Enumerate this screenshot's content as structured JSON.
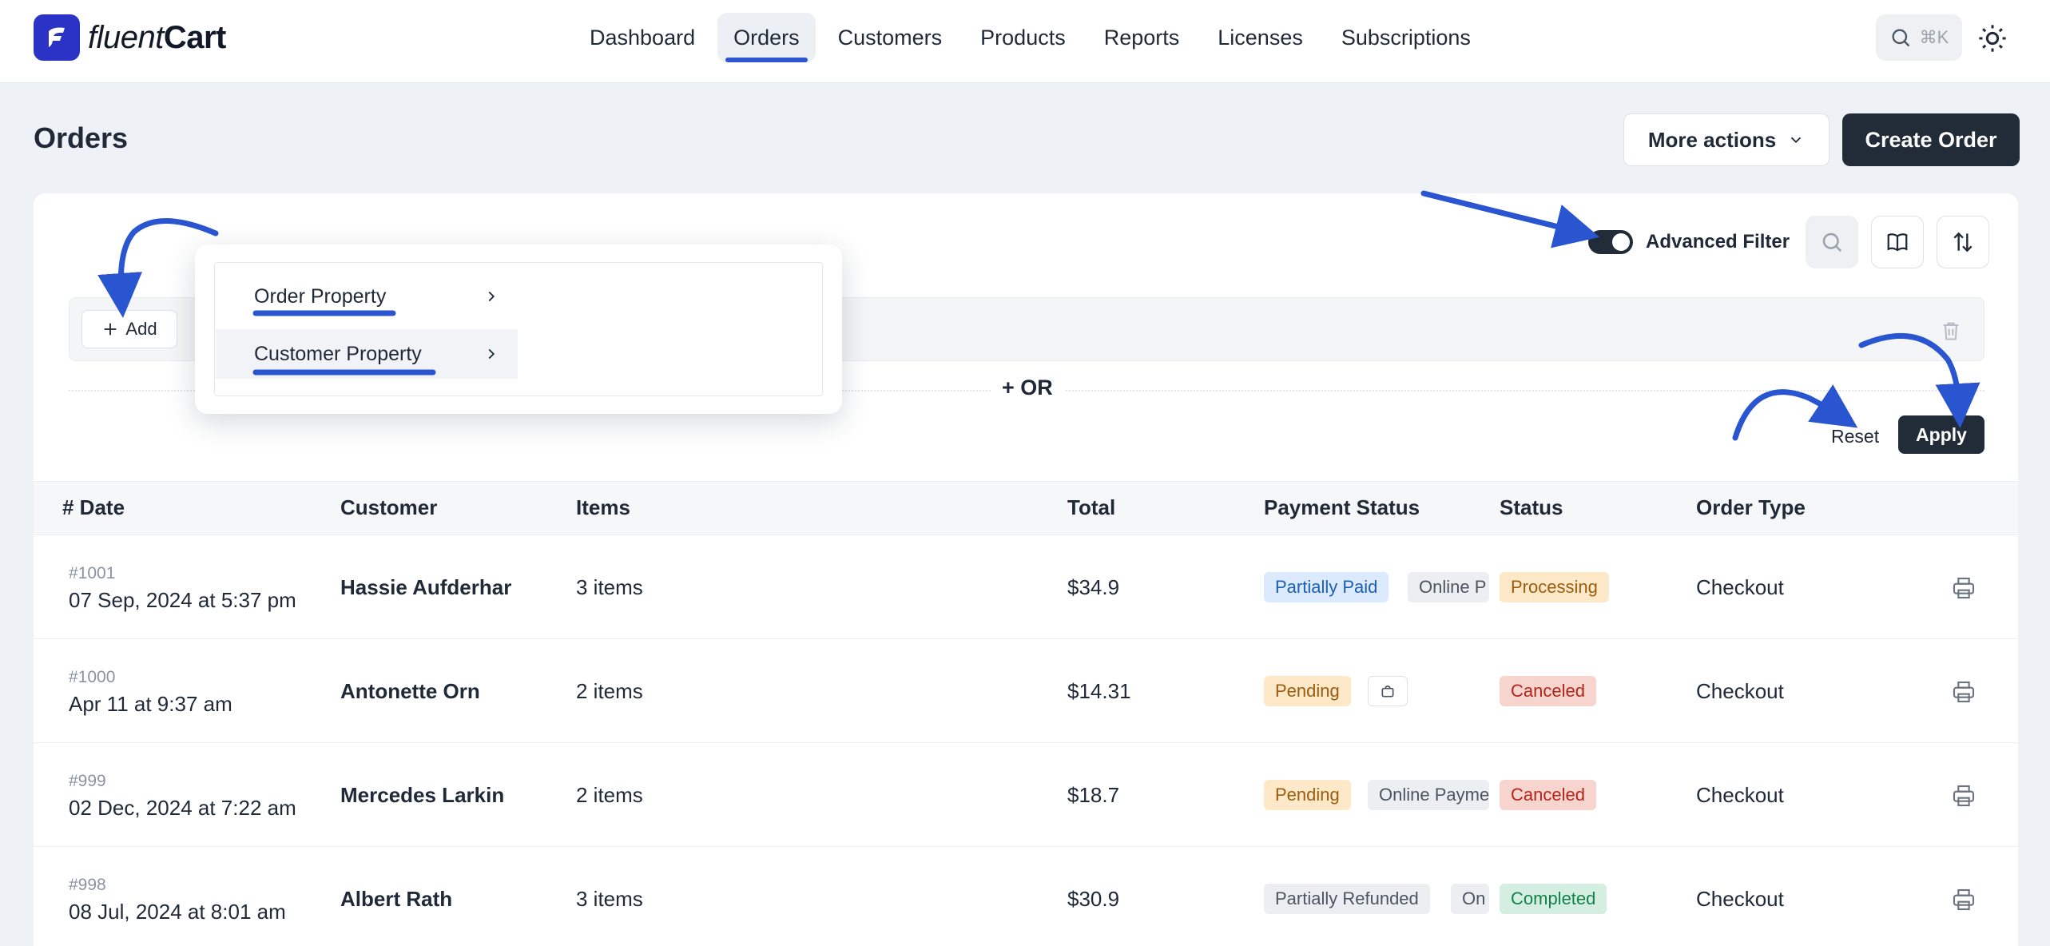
{
  "brand": {
    "name_light": "fluent",
    "name_strong": "Cart"
  },
  "nav": {
    "items": [
      "Dashboard",
      "Orders",
      "Customers",
      "Products",
      "Reports",
      "Licenses",
      "Subscriptions"
    ],
    "active": "Orders"
  },
  "search": {
    "shortcut": "⌘K"
  },
  "page": {
    "title": "Orders"
  },
  "header_actions": {
    "more_actions": "More actions",
    "create_order": "Create Order"
  },
  "filter": {
    "advanced_label": "Advanced Filter",
    "advanced_enabled": true,
    "add_label": "Add",
    "or_label": "+ OR",
    "reset_label": "Reset",
    "apply_label": "Apply",
    "dropdown_items": [
      "Order Property",
      "Customer Property"
    ]
  },
  "table": {
    "columns": [
      "# Date",
      "Customer",
      "Items",
      "Total",
      "Payment Status",
      "Status",
      "Order Type"
    ],
    "rows": [
      {
        "order_no": "#1001",
        "date": "07 Sep, 2024 at 5:37 pm",
        "customer": "Hassie Aufderhar",
        "items": "3 items",
        "total": "$34.9",
        "payment_status": "Partially Paid",
        "payment_method": "Online P",
        "status": "Processing",
        "order_type": "Checkout"
      },
      {
        "order_no": "#1000",
        "date": "Apr 11 at 9:37 am",
        "customer": "Antonette Orn",
        "items": "2 items",
        "total": "$14.31",
        "payment_status": "Pending",
        "payment_method": "",
        "status": "Canceled",
        "order_type": "Checkout"
      },
      {
        "order_no": "#999",
        "date": "02 Dec, 2024 at 7:22 am",
        "customer": "Mercedes Larkin",
        "items": "2 items",
        "total": "$18.7",
        "payment_status": "Pending",
        "payment_method": "Online Payme",
        "status": "Canceled",
        "order_type": "Checkout"
      },
      {
        "order_no": "#998",
        "date": "08 Jul, 2024 at 8:01 am",
        "customer": "Albert Rath",
        "items": "3 items",
        "total": "$30.9",
        "payment_status": "Partially Refunded",
        "payment_method": "On",
        "status": "Completed",
        "order_type": "Checkout"
      }
    ]
  },
  "colors": {
    "accent": "#2f55d4",
    "dark_button": "#222b38",
    "annotation_arrow": "#2a55d1"
  },
  "icons": {
    "search": "search-icon",
    "theme": "sun-icon",
    "chevron": "chevron-down-icon",
    "plus": "plus-icon",
    "trash": "trash-icon",
    "book": "book-icon",
    "sort": "sort-icon",
    "print": "printer-icon",
    "bag": "bag-icon"
  }
}
